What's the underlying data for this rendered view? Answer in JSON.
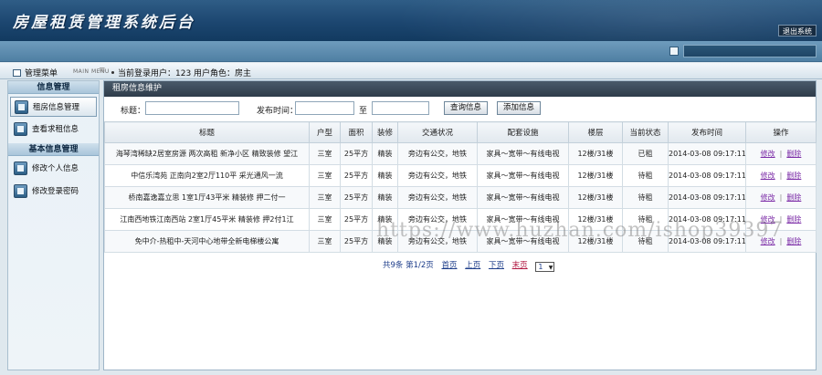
{
  "header": {
    "app_title": "房屋租赁管理系统后台",
    "logout_label": "退出系统"
  },
  "topstrip": {
    "menu_title": "管理菜单",
    "menu_sub": "MAIN MENU",
    "menu_sep": "≡",
    "user_info": "当前登录用户：123  用户角色：房主"
  },
  "sidebar": {
    "sections": [
      {
        "title": "信息管理",
        "items": [
          {
            "label": "租房信息管理",
            "active": true
          },
          {
            "label": "查看求租信息",
            "active": false
          }
        ]
      },
      {
        "title": "基本信息管理",
        "items": [
          {
            "label": "修改个人信息",
            "active": false
          },
          {
            "label": "修改登录密码",
            "active": false
          }
        ]
      }
    ]
  },
  "main": {
    "panel_title": "租房信息维护",
    "search": {
      "title_label": "标题：",
      "title_value": "",
      "time_label": "发布时间：",
      "from_value": "",
      "to_label": "至",
      "to_value": "",
      "query_button": "查询信息",
      "add_button": "添加信息"
    },
    "columns": [
      "标题",
      "户型",
      "面积",
      "装修",
      "交通状况",
      "配套设施",
      "楼层",
      "当前状态",
      "发布时间",
      "操作"
    ],
    "rows": [
      [
        "海琴湾稀缺2居室房源 两次高租 新净小区 精致装修 望江",
        "三室",
        "25平方",
        "精装",
        "旁边有公交，地铁",
        "家具～宽带～有线电视",
        "12楼/31楼",
        "已租",
        "2014-03-08 09:17:11"
      ],
      [
        "中信乐湾苑 正南向2室2厅110平 采光通风一流",
        "三室",
        "25平方",
        "精装",
        "旁边有公交，地铁",
        "家具～宽带～有线电视",
        "12楼/31楼",
        "待租",
        "2014-03-08 09:17:11"
      ],
      [
        "桥南嘉逸嘉立思 1室1厅43平米 精装修 押二付一",
        "三室",
        "25平方",
        "精装",
        "旁边有公交，地铁",
        "家具～宽带～有线电视",
        "12楼/31楼",
        "待租",
        "2014-03-08 09:17:11"
      ],
      [
        "江南西地铁江南西站 2室1厅45平米 精装修 押2付1江",
        "三室",
        "25平方",
        "精装",
        "旁边有公交，地铁",
        "家具～宽带～有线电视",
        "12楼/31楼",
        "待租",
        "2014-03-08 09:17:11"
      ],
      [
        "免中介-热租中-天河中心地带全新电梯楼公寓",
        "三室",
        "25平方",
        "精装",
        "旁边有公交，地铁",
        "家具～宽带～有线电视",
        "12楼/31楼",
        "待租",
        "2014-03-08 09:17:11"
      ]
    ],
    "row_actions": {
      "edit": "修改",
      "delete": "删除"
    },
    "pager": {
      "summary": "共9条 第1/2页",
      "first": "首页",
      "prev": "上页",
      "next": "下页",
      "last": "末页",
      "page_select": "1"
    }
  },
  "watermark": "https://www.huzhan.com/ishop39397",
  "colors": {
    "header": "#1c4670",
    "panel_title": "#2e3c4a",
    "link": "#7a2aa6"
  }
}
